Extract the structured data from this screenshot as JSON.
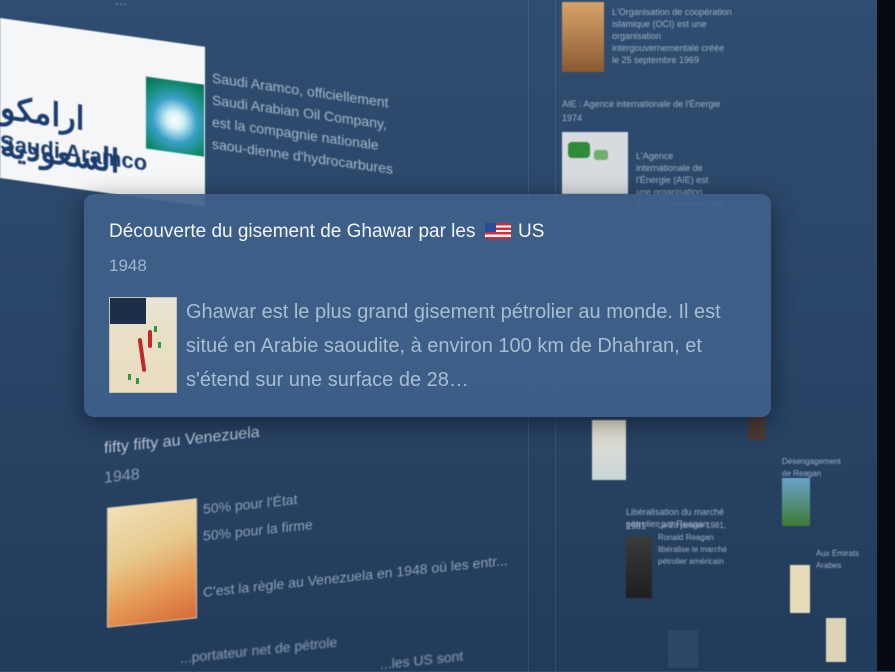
{
  "background_items": {
    "aramco": {
      "logo_arabic": "ارامكو السعودية",
      "logo_english": "Saudi Aramco",
      "description": "Saudi Aramco, officiellement Saudi Arabian Oil Company, est la compagnie nationale saou-dienne d'hydrocarbures"
    },
    "right_column": {
      "item1_text": "L'Organisation de coopération islamique (OCI) est une organisation intergouvernementale créée le 25 septembre 1969",
      "item2_title": "AIE : Agence internationale de l'Énergie",
      "item2_year": "1974",
      "item2_text": "L'Agence internationale de l'Énergie (AIE) est une organisation intergouvernementale",
      "item3_title": "Libéralisation du marché pétrolier par Reagan",
      "item3_year": "1981",
      "item3_text": "Le 28 janvier 1981, Ronald Reagan libéralise le marché pétrolier américain",
      "item4_title": "Désengagement de Reagan",
      "item4_year": "Aux Émirats Arabes"
    },
    "venezuela": {
      "title": "fifty fifty au Venezuela",
      "year": "1948",
      "line1": "50% pour l'État",
      "line2": "50% pour la firme",
      "line3": "C'est la règle au Venezuela en 1948 où les entr..."
    },
    "bottom": {
      "line1": "...portateur net de pétrole",
      "line2": "...les US sont"
    }
  },
  "card": {
    "title": "Découverte du gisement de Ghawar par les",
    "title_suffix": "US",
    "flag_icon": "us-flag-icon",
    "year": "1948",
    "description": "Ghawar est le plus grand gisement pétrolier au monde. Il est situé en Arabie saoudite, à environ 100 km de Dhahran, et s'étend sur une surface de 28…"
  },
  "colors": {
    "background": "#2a4668",
    "card_background": "#3d608a",
    "title_text": "#f1f5f9",
    "secondary_text": "#a3b6ca"
  }
}
